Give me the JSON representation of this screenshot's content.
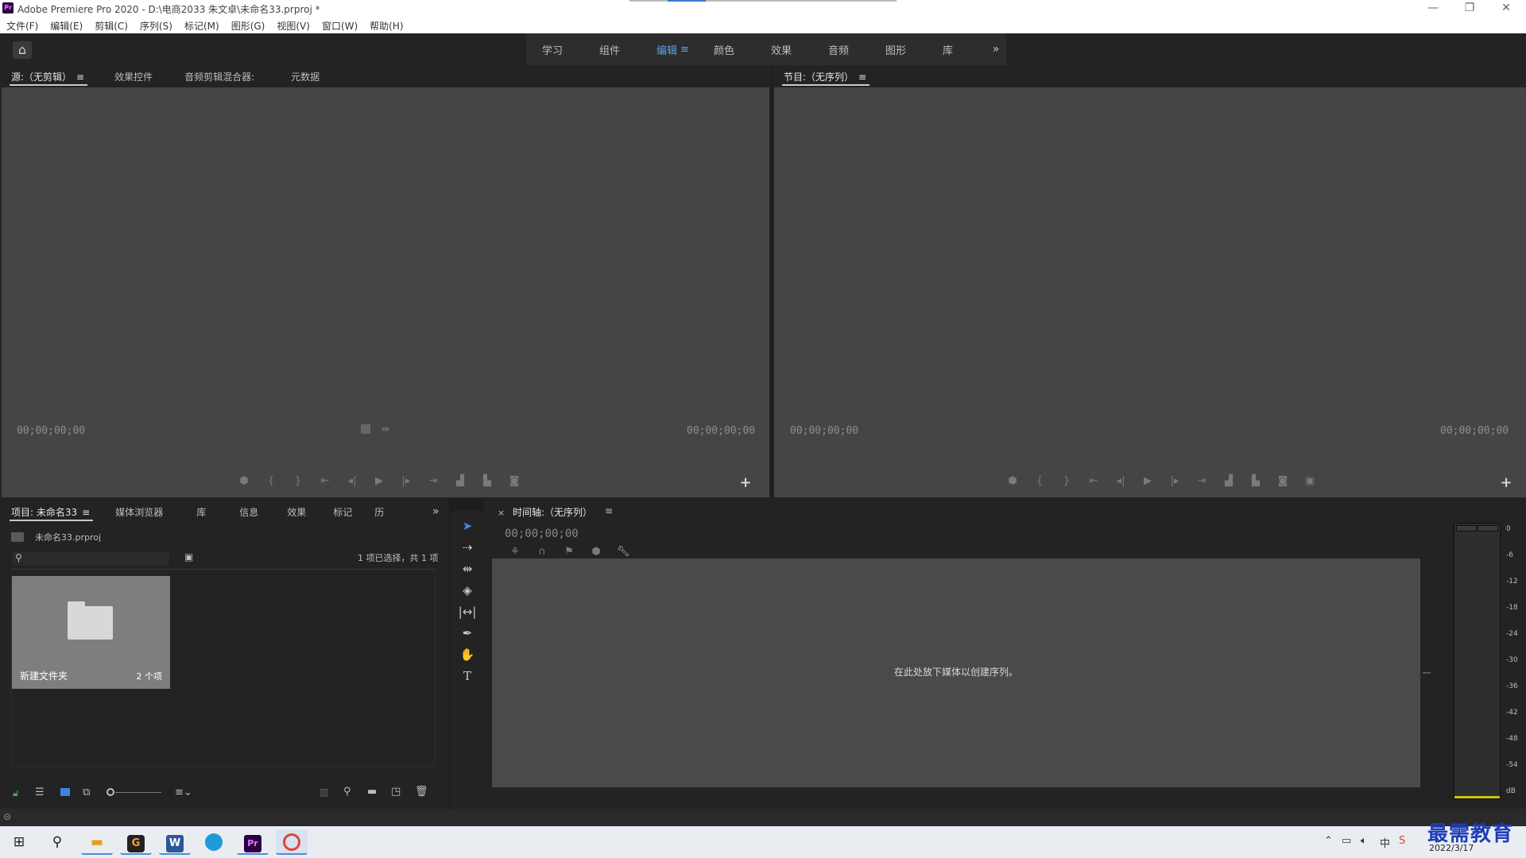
{
  "window": {
    "logo_text": "Pr",
    "title": "Adobe Premiere Pro 2020 - D:\\电商2033 朱文卓\\未命名33.prproj *",
    "minimize": "—",
    "restore": "❐",
    "close": "✕"
  },
  "menubar": {
    "items": [
      "文件(F)",
      "编辑(E)",
      "剪辑(C)",
      "序列(S)",
      "标记(M)",
      "图形(G)",
      "视图(V)",
      "窗口(W)",
      "帮助(H)"
    ]
  },
  "workspaces": {
    "tabs": [
      "学习",
      "组件",
      "编辑",
      "颜色",
      "效果",
      "音频",
      "图形",
      "库"
    ],
    "active": "编辑",
    "menu_glyph": "≡",
    "more_glyph": "»"
  },
  "source_panel": {
    "tabs": [
      "源:（无剪辑）",
      "效果控件",
      "音频剪辑混合器:",
      "元数据"
    ],
    "menu_glyph": "≡",
    "timecode_left": "00;00;00;00",
    "timecode_right": "00;00;00;00"
  },
  "program_panel": {
    "tab": "节目:（无序列）",
    "menu_glyph": "≡",
    "timecode_left": "00;00;00;00",
    "timecode_right": "00;00;00;00"
  },
  "project_panel": {
    "tabs": [
      "项目: 未命名33",
      "媒体浏览器",
      "库",
      "信息",
      "效果",
      "标记",
      "历"
    ],
    "menu_glyph": "≡",
    "more_glyph": "»",
    "file_name": "未命名33.prproj",
    "selection_status": "1 项已选择，共 1 项",
    "folder": {
      "name": "新建文件夹",
      "count": "2 个项"
    }
  },
  "timeline_panel": {
    "close_glyph": "×",
    "tab": "时间轴:（无序列）",
    "menu_glyph": "≡",
    "timecode": "00;00;00;00",
    "drop_hint": "在此处放下媒体以创建序列。"
  },
  "meter": {
    "db_labels": [
      "0",
      "-6",
      "-12",
      "-18",
      "-24",
      "-30",
      "-36",
      "-42",
      "-48",
      "-54",
      "dB"
    ]
  },
  "taskbar": {
    "date": "2022/3/17",
    "watermark": "最需教育"
  }
}
